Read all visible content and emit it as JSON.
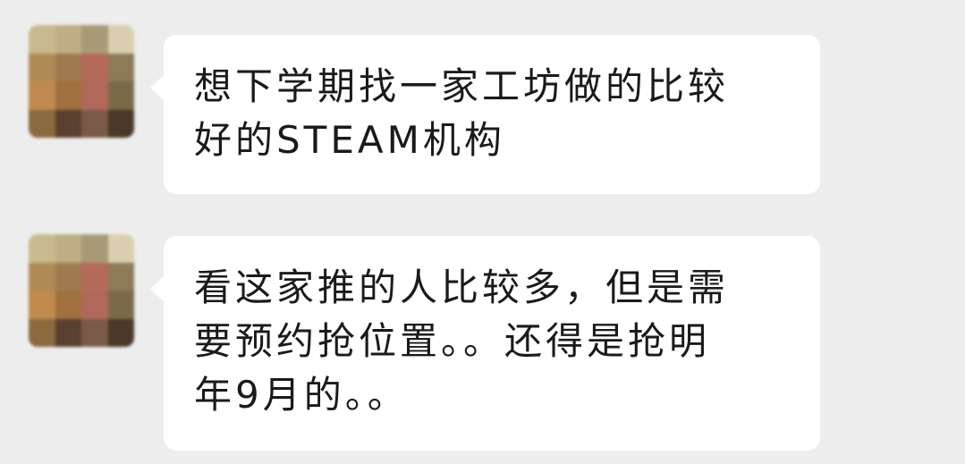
{
  "messages": [
    {
      "sender": "contact",
      "text": "想下学期找一家工坊做的比较\n好的STEAM机构"
    },
    {
      "sender": "contact",
      "text": "看这家推的人比较多，但是需\n要预约抢位置。。还得是抢明\n年9月的。。"
    }
  ],
  "colors": {
    "background": "#ededed",
    "bubble": "#ffffff",
    "text": "#1a1a1a"
  }
}
